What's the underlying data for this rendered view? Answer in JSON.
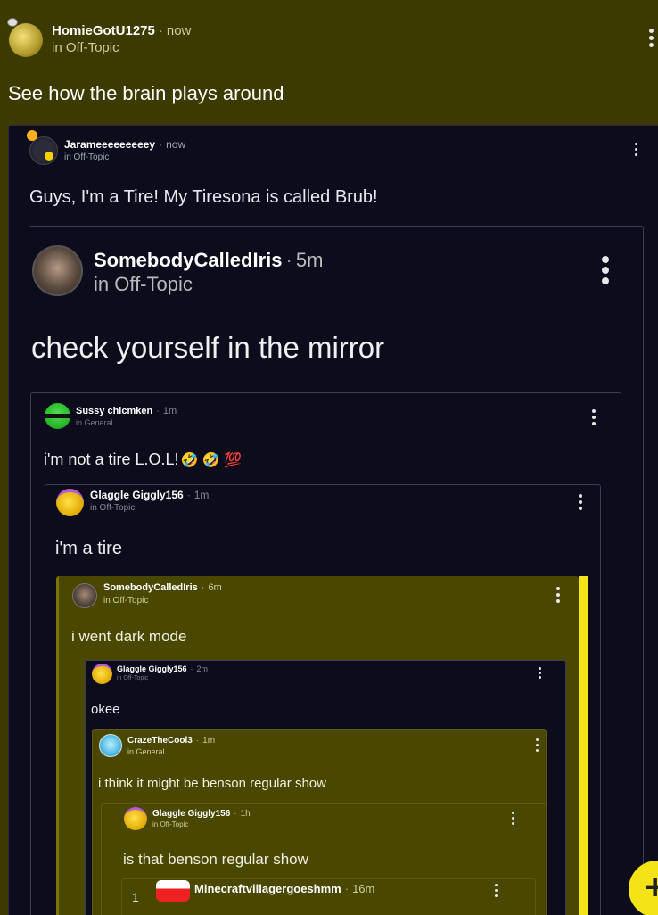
{
  "post": {
    "username": "HomieGotU1275",
    "time": "now",
    "community": "in Off-Topic",
    "title": "See how the brain plays around"
  },
  "quote1": {
    "username": "Jarameeeeeeeeey",
    "time": "now",
    "community": "in Off-Topic",
    "text": "Guys, I'm a Tire! My Tiresona is called Brub!"
  },
  "quote2": {
    "username": "SomebodyCalledIris",
    "time": "5m",
    "community": "in Off-Topic",
    "text": "check yourself in the mirror"
  },
  "quote3": {
    "username": "Sussy chicmken",
    "time": "1m",
    "community": "in General",
    "text": "i'm not a tire L.O.L!",
    "emoji": "🤣 🤣 💯"
  },
  "quote4": {
    "username": "Glaggle Giggly156",
    "time": "1m",
    "community": "in Off-Topic",
    "text": "i'm a tire"
  },
  "quote5": {
    "username": "SomebodyCalledIris",
    "time": "6m",
    "community": "in Off-Topic",
    "text": "i went dark mode"
  },
  "quote6": {
    "username": "Glaggle Giggly156",
    "time": "2m",
    "community": "in Off-Topic",
    "text": "okee"
  },
  "quote7": {
    "username": "CrazeTheCool3",
    "time": "1m",
    "community": "in General",
    "text": "i think it might be benson regular show"
  },
  "quote8": {
    "username": "Glaggle Giggly156",
    "time": "1h",
    "community": "in Off-Topic",
    "text": "is that benson regular show"
  },
  "quote9": {
    "username": "Minecraftvillagergoeshmm",
    "time": "16m",
    "badge": "1"
  },
  "fab": {
    "label": "+"
  },
  "separator": "·",
  "colors": {
    "page_bg": "#3d3a00",
    "dark_card": "#0c0c1c",
    "olive_card": "#4a4700",
    "accent_yellow": "#f4e316"
  }
}
